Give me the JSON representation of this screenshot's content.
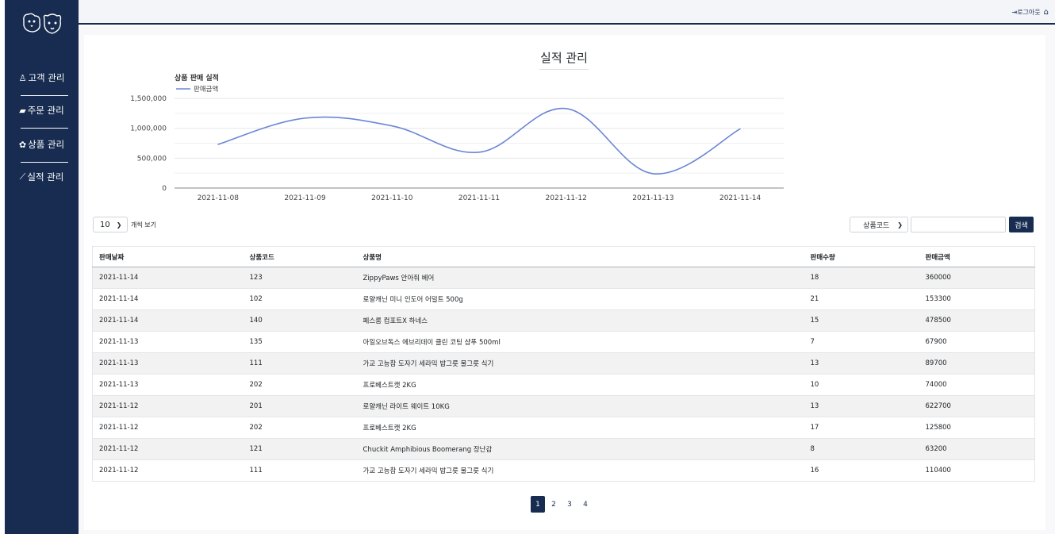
{
  "sidebar": {
    "items": [
      {
        "icon": "person-icon",
        "glyph": "♙",
        "label": "고객 관리"
      },
      {
        "icon": "cart-icon",
        "glyph": "▰",
        "label": "주문 관리"
      },
      {
        "icon": "gift-icon",
        "glyph": "✿",
        "label": "상품 관리"
      },
      {
        "icon": "chart-line-icon",
        "glyph": "⟋",
        "label": "실적 관리"
      }
    ],
    "color": "#172c50"
  },
  "header": {
    "logout_label": "로그아웃",
    "logout_icon": "sign-out-icon",
    "home_icon": "home-icon"
  },
  "page": {
    "title": "실적 관리"
  },
  "chart_data": {
    "type": "line",
    "title": "상품 판매 실적",
    "legend": "top-left",
    "categories": [
      "2021-11-08",
      "2021-11-09",
      "2021-11-10",
      "2021-11-11",
      "2021-11-12",
      "2021-11-13",
      "2021-11-14"
    ],
    "series": [
      {
        "name": "판매금액",
        "color": "#6a86d6",
        "values": [
          730000,
          1170000,
          1040000,
          600000,
          1330000,
          240000,
          990000
        ]
      }
    ],
    "ylim": [
      0,
      1500000
    ],
    "yticks": [
      "0",
      "500,000",
      "1,000,000",
      "1,500,000"
    ],
    "grid": true
  },
  "table_controls": {
    "length_value": "10",
    "length_label": "개씩 보기",
    "search_field": "상품코드",
    "search_button": "검색"
  },
  "table": {
    "headers": [
      "판매날짜",
      "상품코드",
      "상품명",
      "판매수량",
      "판매금액"
    ],
    "rows": [
      [
        "2021-11-14",
        "123",
        "ZippyPaws 안아줘 베어",
        "18",
        "360000"
      ],
      [
        "2021-11-14",
        "102",
        "로얄캐닌 미니 인도어 어덜트 500g",
        "21",
        "153300"
      ],
      [
        "2021-11-14",
        "140",
        "페스룸 컴포트X 하네스",
        "15",
        "478500"
      ],
      [
        "2021-11-13",
        "135",
        "아일오브독스 에브리데이 클린 코팅 샴푸 500ml",
        "7",
        "67900"
      ],
      [
        "2021-11-13",
        "111",
        "가교 고능참 도자기 세라믹 밥그릇 물그릇 식기",
        "13",
        "89700"
      ],
      [
        "2021-11-13",
        "202",
        "프로베스트캣 2KG",
        "10",
        "74000"
      ],
      [
        "2021-11-12",
        "201",
        "로얄캐닌 라이트 웨이트 10KG",
        "13",
        "622700"
      ],
      [
        "2021-11-12",
        "202",
        "프로베스트캣 2KG",
        "17",
        "125800"
      ],
      [
        "2021-11-12",
        "121",
        "Chuckit Amphibious Boomerang 장난감",
        "8",
        "63200"
      ],
      [
        "2021-11-12",
        "111",
        "가교 고능참 도자기 세라믹 밥그릇 물그릇 식기",
        "16",
        "110400"
      ]
    ]
  },
  "pagination": {
    "pages": [
      "1",
      "2",
      "3",
      "4"
    ],
    "active": "1"
  }
}
